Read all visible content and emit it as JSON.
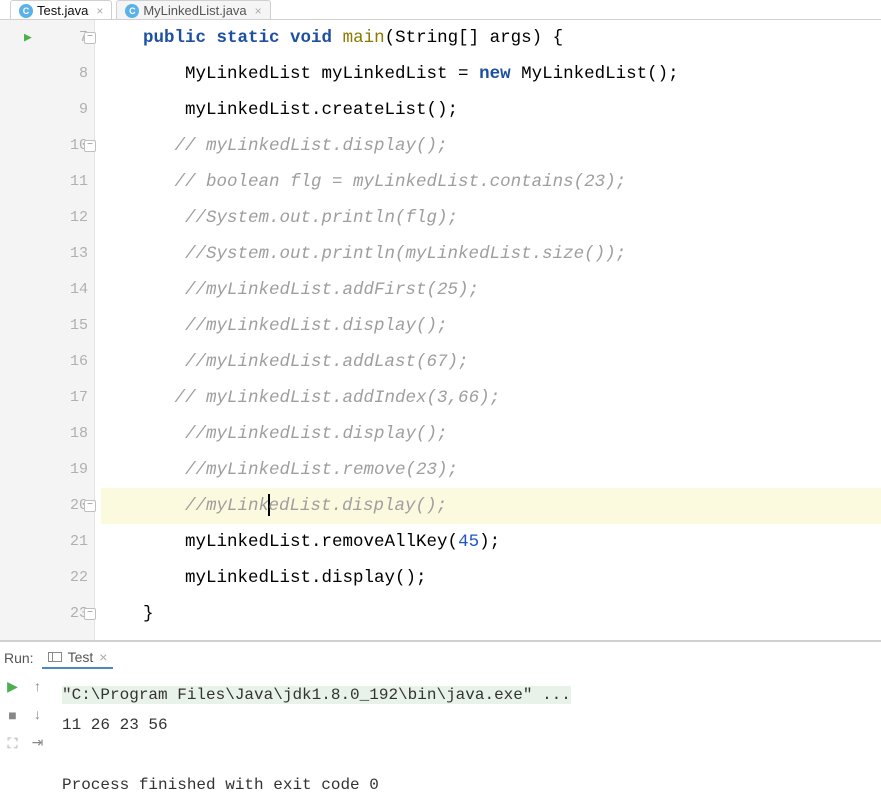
{
  "tabs": [
    {
      "label": "Test.java",
      "active": true
    },
    {
      "label": "MyLinkedList.java",
      "active": false
    }
  ],
  "lines": {
    "start": 7,
    "rows": [
      {
        "n": 7,
        "run": true,
        "fold": "-",
        "tokens": [
          [
            "    ",
            ""
          ],
          [
            "public ",
            "kw"
          ],
          [
            "static ",
            "kw"
          ],
          [
            "void ",
            "kw"
          ],
          [
            "main",
            "fn"
          ],
          [
            "(String[] args) {",
            ""
          ]
        ]
      },
      {
        "n": 8,
        "tokens": [
          [
            "        MyLinkedList myLinkedList = ",
            ""
          ],
          [
            "new ",
            "kw"
          ],
          [
            "MyLinkedList();",
            ""
          ]
        ]
      },
      {
        "n": 9,
        "tokens": [
          [
            "        myLinkedList.createList();",
            ""
          ]
        ]
      },
      {
        "n": 10,
        "fold": "-",
        "tokens": [
          [
            "       ",
            ""
          ],
          [
            "// myLinkedList.display();",
            "cm"
          ]
        ]
      },
      {
        "n": 11,
        "tokens": [
          [
            "       ",
            ""
          ],
          [
            "// boolean flg = myLinkedList.contains(23);",
            "cm"
          ]
        ]
      },
      {
        "n": 12,
        "tokens": [
          [
            "        ",
            ""
          ],
          [
            "//System.out.println(flg);",
            "cm"
          ]
        ]
      },
      {
        "n": 13,
        "tokens": [
          [
            "        ",
            ""
          ],
          [
            "//System.out.println(myLinkedList.size());",
            "cm"
          ]
        ]
      },
      {
        "n": 14,
        "tokens": [
          [
            "        ",
            ""
          ],
          [
            "//myLinkedList.addFirst(25);",
            "cm"
          ]
        ]
      },
      {
        "n": 15,
        "tokens": [
          [
            "        ",
            ""
          ],
          [
            "//myLinkedList.display();",
            "cm"
          ]
        ]
      },
      {
        "n": 16,
        "tokens": [
          [
            "        ",
            ""
          ],
          [
            "//myLinkedList.addLast(67);",
            "cm"
          ]
        ]
      },
      {
        "n": 17,
        "tokens": [
          [
            "       ",
            ""
          ],
          [
            "// myLinkedList.addIndex(3,66);",
            "cm"
          ]
        ]
      },
      {
        "n": 18,
        "tokens": [
          [
            "        ",
            ""
          ],
          [
            "//myLinkedList.display();",
            "cm"
          ]
        ]
      },
      {
        "n": 19,
        "tokens": [
          [
            "        ",
            ""
          ],
          [
            "//myLinkedList.remove(23);",
            "cm"
          ]
        ]
      },
      {
        "n": 20,
        "fold": "-",
        "hl": true,
        "cursorAfter": 16,
        "tokens": [
          [
            "        ",
            ""
          ],
          [
            "//myLinkedList.display();",
            "cm"
          ]
        ]
      },
      {
        "n": 21,
        "tokens": [
          [
            "        myLinkedList.removeAllKey(",
            ""
          ],
          [
            "45",
            "num"
          ],
          [
            ");",
            ""
          ]
        ]
      },
      {
        "n": 22,
        "tokens": [
          [
            "        myLinkedList.display();",
            ""
          ]
        ]
      },
      {
        "n": 23,
        "fold": "-",
        "tokens": [
          [
            "    }",
            ""
          ]
        ]
      }
    ]
  },
  "run": {
    "label": "Run:",
    "tab_name": "Test",
    "cmd": "\"C:\\Program Files\\Java\\jdk1.8.0_192\\bin\\java.exe\" ...",
    "output": "11 26 23 56",
    "exit": "Process finished with exit code 0"
  }
}
